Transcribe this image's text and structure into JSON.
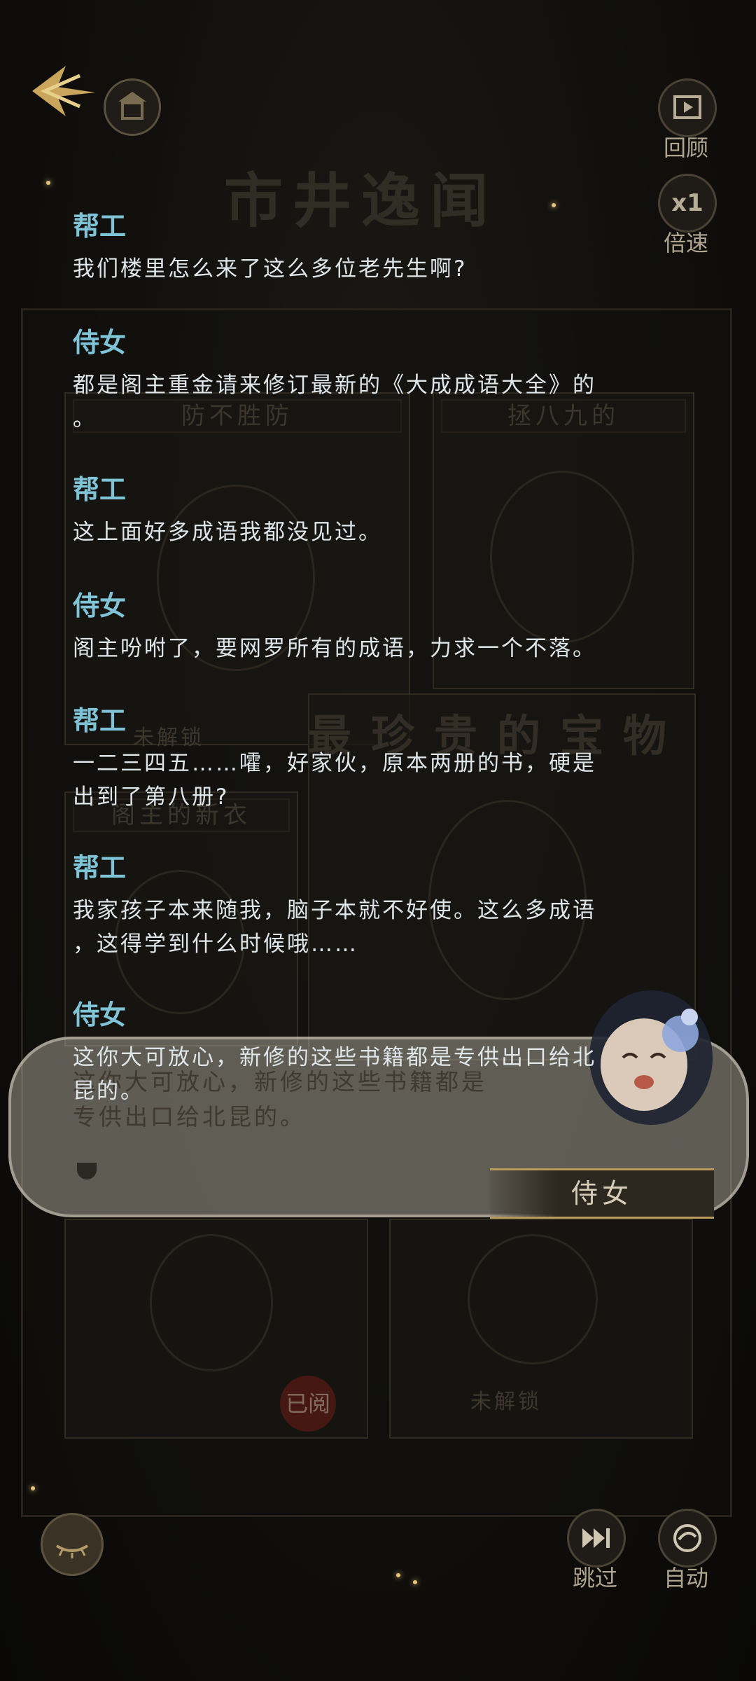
{
  "header": {
    "back_icon": "back-arrow-icon",
    "home_icon": "home-pavilion-icon",
    "banner_title": "市井逸闻"
  },
  "controls": {
    "review_label": "回顾",
    "speed_value": "x1",
    "speed_label": "倍速",
    "skip_label": "跳过",
    "auto_label": "自动"
  },
  "gallery": {
    "title": "最珍贵的宝物",
    "panel1_title": "防不胜防",
    "panel2_title": "拯八九的",
    "panel3_title": "阁主的新衣",
    "locked_label": "未解锁",
    "read_stamp": "已阅"
  },
  "log": [
    {
      "speaker": "帮工",
      "lines": [
        "我们楼里怎么来了这么多位老先生啊?"
      ]
    },
    {
      "speaker": "侍女",
      "lines": [
        "都是阁主重金请来修订最新的《大成成语大全》的",
        "。"
      ]
    },
    {
      "speaker": "帮工",
      "lines": [
        "这上面好多成语我都没见过。"
      ]
    },
    {
      "speaker": "侍女",
      "lines": [
        "阁主吩咐了，要网罗所有的成语，力求一个不落。"
      ]
    },
    {
      "speaker": "帮工",
      "lines": [
        "一二三四五……嚯，好家伙，原本两册的书，硬是",
        "出到了第八册?"
      ]
    },
    {
      "speaker": "帮工",
      "lines": [
        "我家孩子本来随我，脑子本就不好使。这么多成语",
        "，这得学到什么时候哦……"
      ]
    },
    {
      "speaker": "侍女",
      "lines": [
        "这你大可放心，新修的这些书籍都是专供出口给北",
        "昆的。"
      ]
    }
  ],
  "dialog": {
    "line1": "这你大可放心，新修的这些书籍都是",
    "line2": "专供出口给北昆的。",
    "speaker_name": "侍女"
  },
  "colors": {
    "speaker": "#7fc3d6",
    "text": "#dfe6ea",
    "accent_gold": "#b89a5c"
  }
}
